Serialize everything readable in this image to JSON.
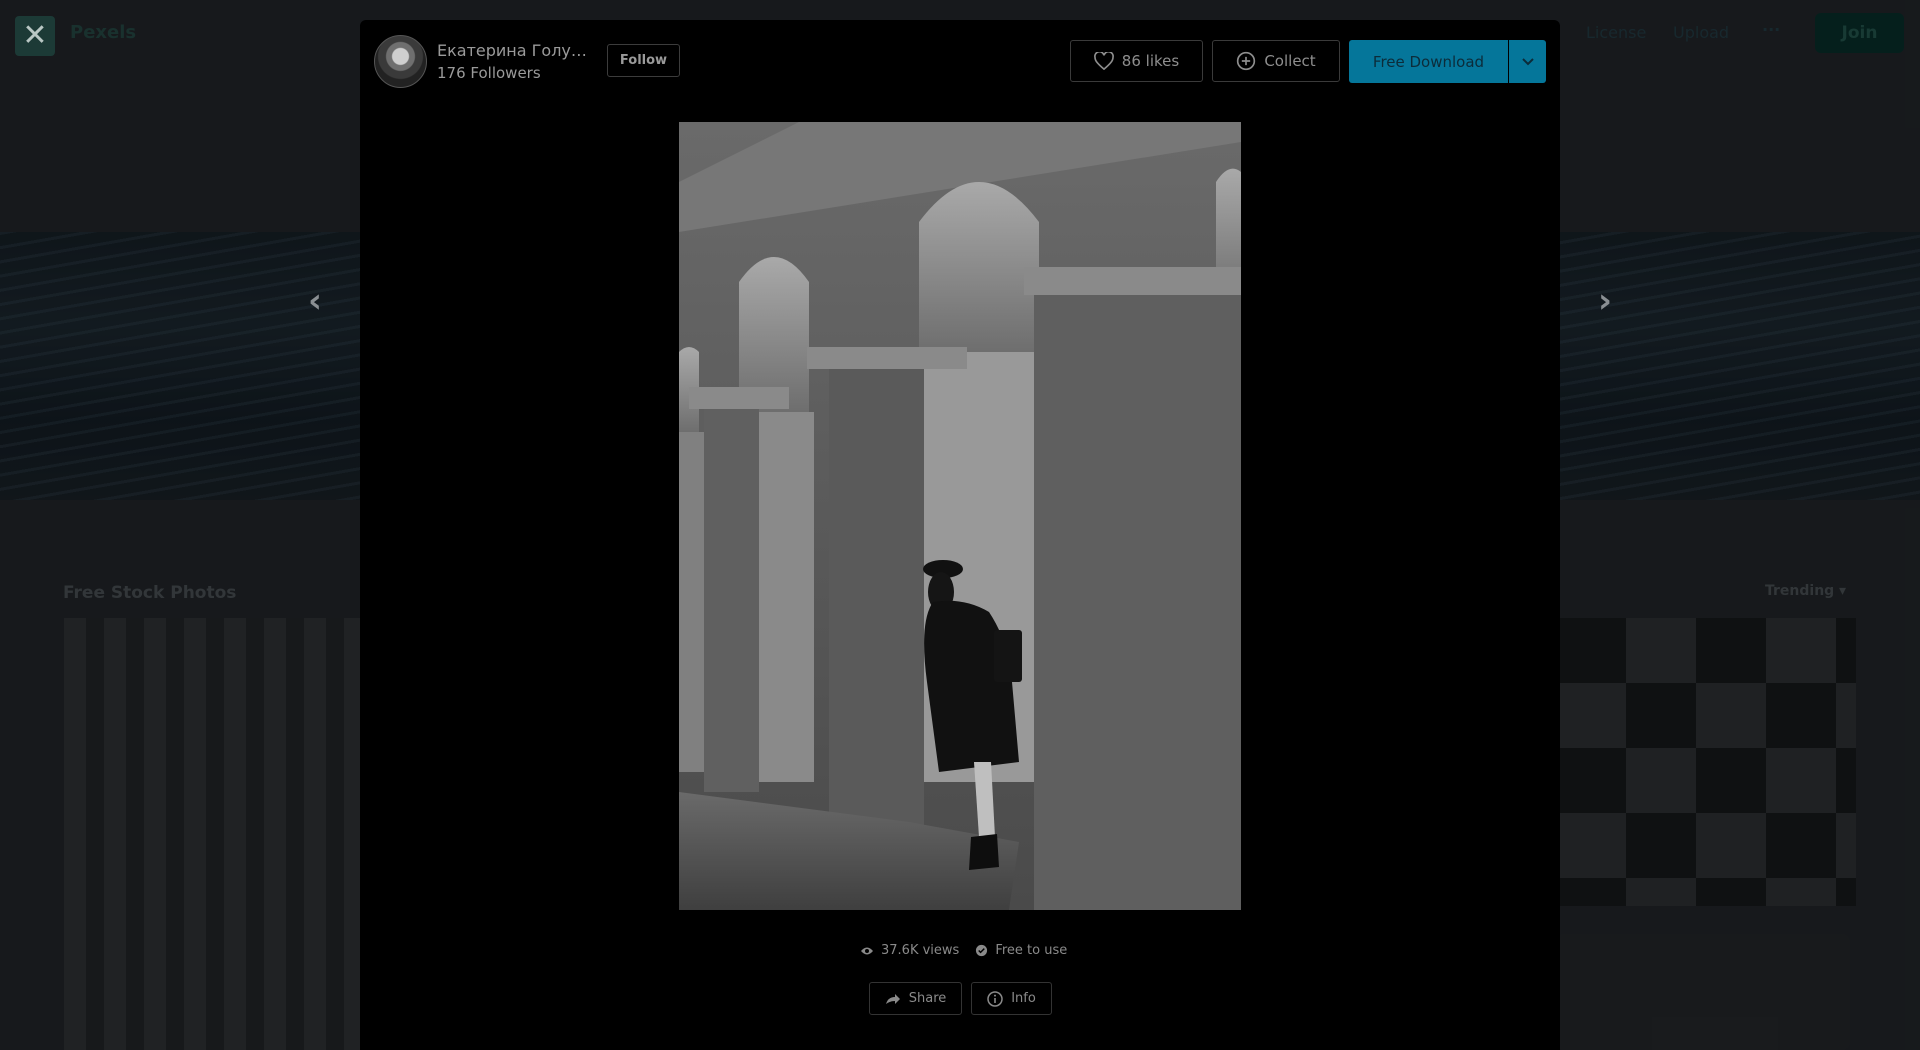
{
  "background": {
    "brand": "Pexels",
    "nav_links": [
      "License",
      "Upload"
    ],
    "more_label": "···",
    "join_label": "Join",
    "section_title": "Free Stock Photos",
    "trending_label": "Trending"
  },
  "modal": {
    "author": {
      "name": "Екатерина Голуб...",
      "followers": "176 Followers",
      "follow_label": "Follow"
    },
    "likes_label": "86 likes",
    "collect_label": "Collect",
    "download_label": "Free Download",
    "stats": {
      "views": "37.6K views",
      "license": "Free to use"
    },
    "share_label": "Share",
    "info_label": "Info"
  },
  "colors": {
    "accent": "#05769a",
    "modal_bg": "#000000"
  }
}
